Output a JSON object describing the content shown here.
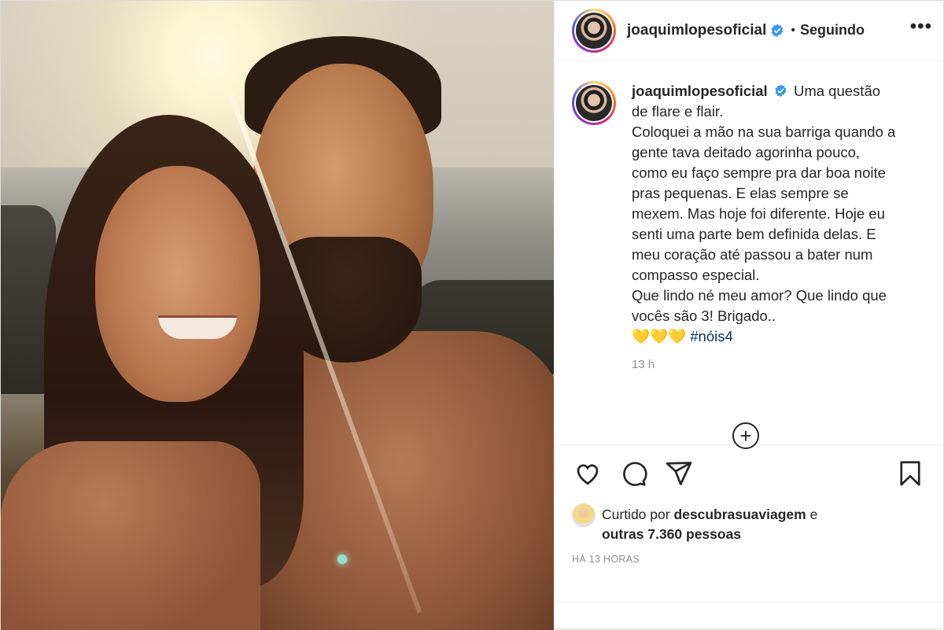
{
  "post": {
    "username": "joaquimlopesoficial",
    "follow_status": "Seguindo",
    "header_separator": "•",
    "more_label": "•••",
    "caption": {
      "first_line": "Uma questão de flare e flair.",
      "paragraph": "Coloquei a mão na sua barriga quando a gente tava deitado agorinha pouco, como eu faço sempre pra dar boa noite pras pequenas. E elas sempre se mexem. Mas hoje foi diferente. Hoje eu senti uma parte bem definida delas. E meu coração até passou a bater num compasso especial.",
      "closing": "Que lindo né meu amor? Que lindo que vocês são 3! Brigado..",
      "emojis": "💛💛💛",
      "hashtag": "#nóis4"
    },
    "caption_time": "13 h",
    "load_more_label": "+",
    "likes": {
      "prefix": "Curtido por",
      "liker": "descubrasuaviagem",
      "connector": "e",
      "others": "outras 7.360 pessoas"
    },
    "posted_ago": "HÁ 13 HORAS"
  },
  "icons": {
    "like": "heart-icon",
    "comment": "comment-icon",
    "share": "share-icon",
    "save": "bookmark-icon",
    "verified": "verified-badge-icon",
    "load_more": "plus-circle-icon"
  },
  "colors": {
    "verified": "#3897f0",
    "hashtag": "#00376b",
    "muted": "#8e8e8e",
    "text": "#262626"
  }
}
